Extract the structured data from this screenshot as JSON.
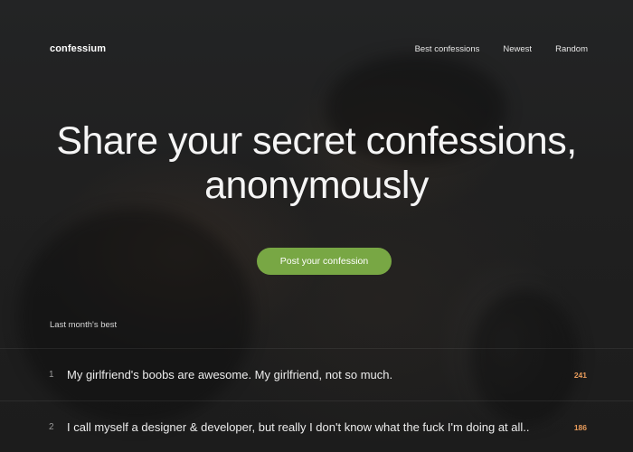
{
  "nav": {
    "logo": "confessium",
    "links": [
      "Best confessions",
      "Newest",
      "Random"
    ]
  },
  "hero": {
    "title_line1": "Share your secret confessions,",
    "title_line2": "anonymously",
    "cta_label": "Post your confession"
  },
  "best": {
    "label": "Last month's best",
    "items": [
      {
        "rank": "1",
        "text": "My girlfriend's boobs are awesome. My girlfriend, not so much.",
        "count": "241"
      },
      {
        "rank": "2",
        "text": "I call myself a designer & developer, but really I don't know what the fuck I'm doing at all..",
        "count": "186"
      }
    ]
  },
  "colors": {
    "accent": "#78a744",
    "count": "#e79b5b",
    "background": "#1f1f1f"
  }
}
